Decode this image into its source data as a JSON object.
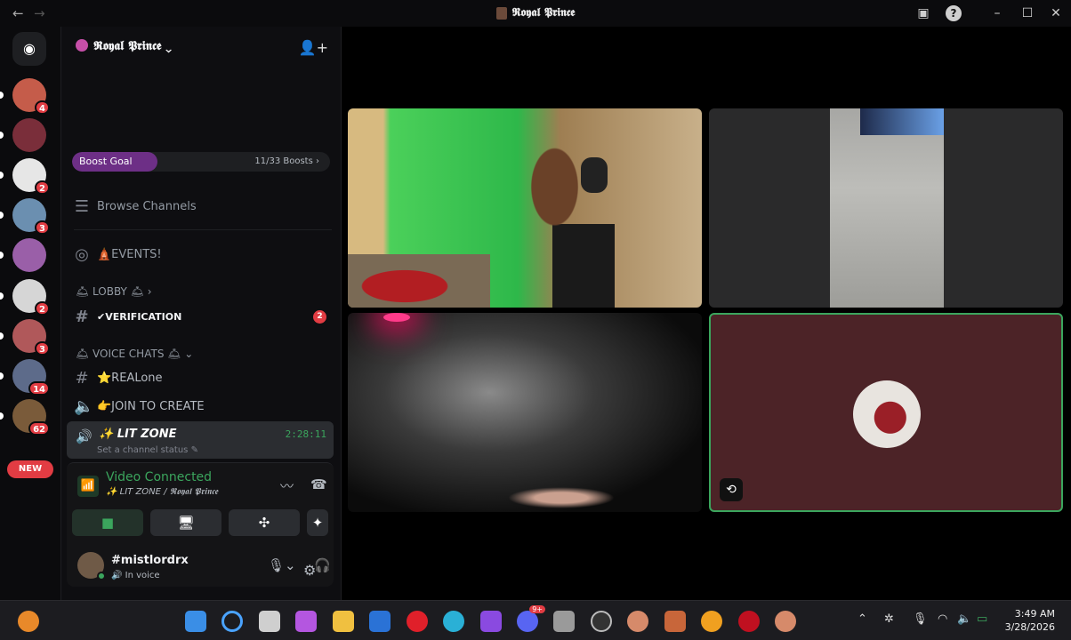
{
  "window": {
    "title": "𝕽𝖔𝖞𝖆𝖑 𝕻𝖗𝖎𝖓𝖈𝖊"
  },
  "servers": [
    {
      "badge": "4",
      "color": "#c55c4a"
    },
    {
      "badge": "",
      "color": "#7a2e3a"
    },
    {
      "badge": "2",
      "color": "#e6e6e6"
    },
    {
      "badge": "3",
      "color": "#6b8fb0"
    },
    {
      "badge": "",
      "color": "#9a5fa8"
    },
    {
      "badge": "2",
      "color": "#d6d6d6"
    },
    {
      "badge": "3",
      "color": "#b0585a"
    },
    {
      "badge": "14",
      "color": "#5d6b8a"
    },
    {
      "badge": "62",
      "color": "#7a5b3a"
    }
  ],
  "rail": {
    "new_label": "NEW"
  },
  "server": {
    "name": "𝕽𝖔𝖞𝖆𝖑 𝕻𝖗𝖎𝖓𝖈𝖊"
  },
  "boost": {
    "label": "Boost Goal",
    "count": "11/33 Boosts",
    "progress": 0.33
  },
  "channels": {
    "browse": "Browse Channels",
    "events": "🛕EVENTS!",
    "lobby_cat": "🛎 LOBBY 🛎",
    "verification": "✔VERIFICATION",
    "verification_mentions": "2",
    "voice_cat": "🛎 VOICE CHATS 🛎",
    "realone": "⭐REALone",
    "join_to_create": "👉JOIN TO CREATE",
    "lit_zone": "✨ LIT ZONE",
    "lit_status": "Set a channel status",
    "lit_timer": "2:28:11"
  },
  "voice_panel": {
    "title": "Video Connected",
    "subtitle": "✨ LIT ZONE / 𝕽𝖔𝖞𝖆𝖑 𝕻𝖗𝖎𝖓𝖈𝖊"
  },
  "user": {
    "name": "#mistlordrx",
    "status": "In voice"
  },
  "taskbar": {
    "time": "3:49 AM",
    "date": "3/28/2026",
    "discord_badge": "9+"
  }
}
